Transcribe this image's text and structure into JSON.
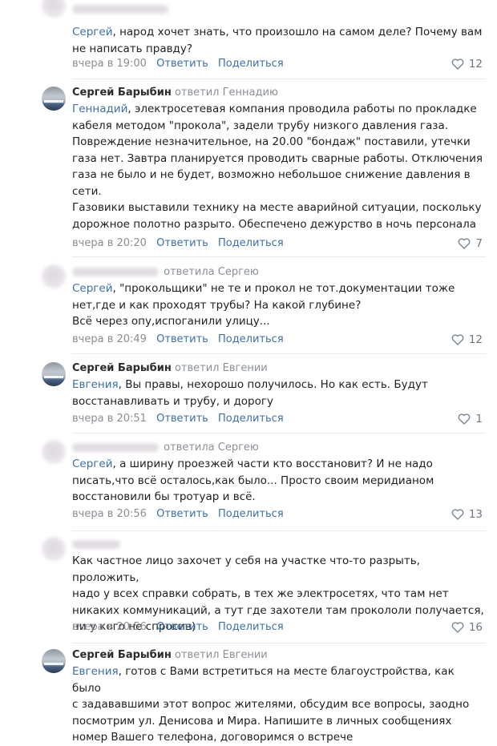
{
  "ui": {
    "reply_label": "Ответить",
    "share_label": "Поделиться"
  },
  "comments": [
    {
      "author": "",
      "replied": "",
      "reply_to": "Сергей",
      "lines": [
        ", народ хочет знать, что произошло на самом деле? Почему вам",
        "не написать правду?"
      ],
      "date": "вчера в 19:00",
      "likes": "12"
    },
    {
      "author": "Сергей Барыбин",
      "replied": "ответил Геннадию",
      "reply_to": "Геннадий",
      "lines": [
        ", электросетевая компания проводила работы по прокладке",
        "кабеля методом \"прокола\", задели трубу низкого давления газа.",
        "Повреждение незначительное, на 20.00 \"бондаж\" поставили, утечки",
        "газа нет. Завтра планируется проводить сварные работы. Отключения",
        "газа не было и не будет, возможно небольшое снижение давления в",
        "сети.",
        "Газовики выставили технику на месте аварийной ситуации, поскольку",
        "дорожное полотно разрыто. Обеспечено дежурство в ночь персонала"
      ],
      "date": "вчера в 20:20",
      "likes": "7"
    },
    {
      "author": "",
      "replied": "ответила Сергею",
      "reply_to": "Сергей",
      "lines": [
        ", \"прокольщики\" не те и прокол не тот.документации тоже",
        "нет,где и как проходят трубы? На какой глубине?",
        "Всё через опу,испоганили улицу..."
      ],
      "date": "вчера в 20:49",
      "likes": "12"
    },
    {
      "author": "Сергей Барыбин",
      "replied": "ответил Евгении",
      "reply_to": "Евгения",
      "lines": [
        ", Вы правы, нехорошо получилось. Но как есть. Будут",
        "восстанавливать и трубу, и дорогу"
      ],
      "date": "вчера в 20:51",
      "likes": "1"
    },
    {
      "author": "",
      "replied": "ответила Сергею",
      "reply_to": "Сергей",
      "lines": [
        ", а ширину проезжей части кто восстановит? И не надо",
        "писать,что всё осталось,как было... Просто своим меридианом",
        "восстановили бы тротуар и всё."
      ],
      "date": "вчера в 20:56",
      "likes": "13"
    },
    {
      "author": "",
      "replied": "",
      "reply_to": "",
      "lines": [
        "Как частное лицо захочет у себя на участке что-то разрыть, проложить,",
        "надо у всех справки собрать, в тех же электросетях, что там нет",
        "никаких коммуникаций, а тут где захотели там прокололи получается,",
        "ни у кого не спросив)"
      ],
      "date": "вчера в 20:56",
      "likes": "16"
    },
    {
      "author": "Сергей Барыбин",
      "replied": "ответил Евгении",
      "reply_to": "Евгения",
      "lines": [
        ", готов с Вами встретиться на месте благоустройства, как было",
        "с задававшими этот вопрос жителями, обсудим все вопросы, заодно",
        "посмотрим ул. Денисова и Мира. Напишите в личных сообщениях",
        "номер Вашего телефона, договоримся о встрече"
      ],
      "date": "",
      "likes": ""
    }
  ]
}
